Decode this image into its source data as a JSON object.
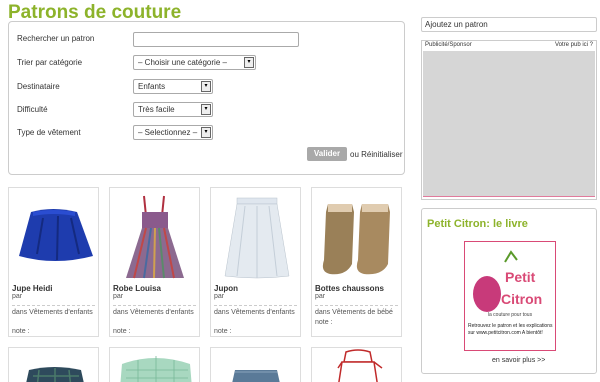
{
  "page": {
    "title": "Patrons de couture"
  },
  "filters": {
    "search_label": "Rechercher un patron",
    "search_value": "",
    "category_label": "Trier par catégorie",
    "category_value": "– Choisir une catégorie –",
    "recipient_label": "Destinataire",
    "recipient_value": "Enfants",
    "difficulty_label": "Difficulté",
    "difficulty_value": "Très facile",
    "garment_label": "Type de vêtement",
    "garment_value": "– Selectionnez –",
    "submit_label": "Valider",
    "reset_prefix": "ou",
    "reset_label": "Réinitialiser"
  },
  "products": [
    {
      "name": "Jupe Heidi",
      "by": "par",
      "in": "dans Vêtements d'enfants",
      "note": "note :"
    },
    {
      "name": "Robe Louisa",
      "by": "par",
      "in": "dans Vêtements d'enfants",
      "note": "note :"
    },
    {
      "name": "Jupon",
      "by": "par",
      "in": "dans Vêtements d'enfants",
      "note": "note :"
    },
    {
      "name": "Bottes chaussons",
      "by": "par",
      "in": "dans Vêtements de bébé",
      "note": "note :"
    }
  ],
  "sidebar": {
    "add_label": "Ajoutez un patron",
    "ad_label": "Publicité/Sponsor",
    "ad_question": "Votre pub ici ?",
    "book_title": "Petit Citron: le livre",
    "cover_logo": "Petit Citron",
    "cover_tagline": "la couture pour tous",
    "cover_text": "Retrouvez le patron et les explications sur www.petitcitron.com A bientôt!",
    "more_label": "en savoir plus >>"
  },
  "colors": {
    "accent": "#8db32b",
    "pink": "#d94a76"
  }
}
